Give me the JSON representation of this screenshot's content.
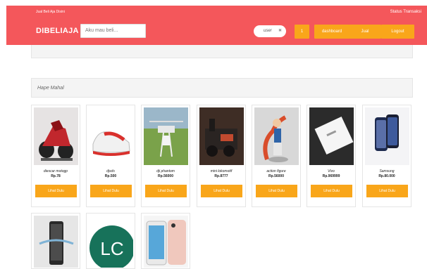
{
  "header": {
    "tagline": "Jual Beli Aja Disini",
    "status_link": "Status Transaksi",
    "brand": "DIBELIAJA",
    "search_placeholder": "Aku mau beli...",
    "user_chip": "user",
    "nav": {
      "cart": "1",
      "dashboard": "dashboard",
      "jual": "Jual",
      "logout": "Logout"
    },
    "color": "#f4575b",
    "accent": "#f9a61a"
  },
  "section": {
    "title": "Hape Mahal"
  },
  "products": [
    {
      "name": "diescar motogp",
      "price": "Rp.78",
      "button": "Lihat Dulu"
    },
    {
      "name": "djsds",
      "price": "Rp.500",
      "button": "Lihat Dulu"
    },
    {
      "name": "dji phantom",
      "price": "Rp.56000",
      "button": "Lihat Dulu"
    },
    {
      "name": "mini lokomotif",
      "price": "Rp.8777",
      "button": "Lihat Dulu"
    },
    {
      "name": "action figure",
      "price": "Rp.56000",
      "button": "Lihat Dulu"
    },
    {
      "name": "Vivo",
      "price": "Rp.969999",
      "button": "Lihat Dulu"
    },
    {
      "name": "Samsung",
      "price": "Rp.80.000",
      "button": "Lihat Dulu"
    }
  ],
  "second_row": {
    "logo_text": "LC"
  }
}
